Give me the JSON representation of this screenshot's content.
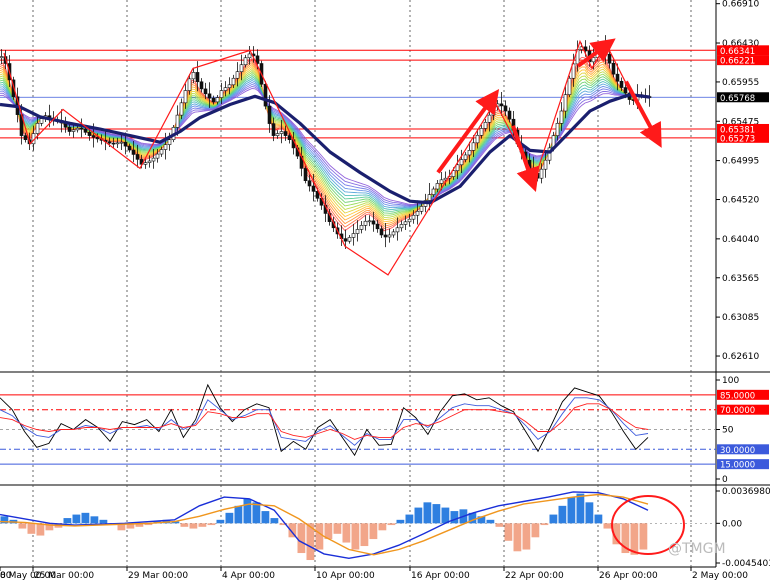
{
  "chart_data": [
    {
      "type": "line",
      "panel": "price",
      "title": "",
      "ylim": [
        0.62415,
        0.66955
      ],
      "y_ticks": [
        "0.66910",
        "0.66430",
        "0.65955",
        "0.65475",
        "0.64995",
        "0.64520",
        "0.64040",
        "0.63565",
        "0.63085",
        "0.62610"
      ],
      "price_tags": [
        {
          "label": "0.66341",
          "value": 0.66341,
          "color": "#ff0000"
        },
        {
          "label": "0.66221",
          "value": 0.66221,
          "color": "#ff0000"
        },
        {
          "label": "0.65768",
          "value": 0.65768,
          "color": "#000000"
        },
        {
          "label": "0.65381",
          "value": 0.65381,
          "color": "#ff0000"
        },
        {
          "label": "0.65273",
          "value": 0.65273,
          "color": "#ff0000"
        }
      ],
      "horizontal_lines": [
        {
          "value": 0.66341,
          "color": "#ff0000"
        },
        {
          "value": 0.66221,
          "color": "#ff0000"
        },
        {
          "value": 0.65768,
          "color": "#3c5adc"
        },
        {
          "value": 0.65381,
          "color": "#ff0000"
        },
        {
          "value": 0.65273,
          "color": "#ff0000"
        }
      ],
      "x_labels": [
        "25 Mar 00:00",
        "29 Mar 00:00",
        "4 Apr 00:00",
        "10 Apr 00:00",
        "16 Apr 00:00",
        "22 Apr 00:00",
        "26 Apr 00:00",
        "2 May 00:00",
        "8 May 00:00"
      ],
      "x_label_edge": "00",
      "price_path": [
        {
          "x": 0,
          "y": 0.6625
        },
        {
          "x": 4,
          "y": 0.6628
        },
        {
          "x": 10,
          "y": 0.6598
        },
        {
          "x": 17,
          "y": 0.6562
        },
        {
          "x": 22,
          "y": 0.653
        },
        {
          "x": 30,
          "y": 0.652
        },
        {
          "x": 38,
          "y": 0.6545
        },
        {
          "x": 45,
          "y": 0.6555
        },
        {
          "x": 52,
          "y": 0.655
        },
        {
          "x": 60,
          "y": 0.6548
        },
        {
          "x": 70,
          "y": 0.6535
        },
        {
          "x": 80,
          "y": 0.654
        },
        {
          "x": 90,
          "y": 0.653
        },
        {
          "x": 100,
          "y": 0.6525
        },
        {
          "x": 112,
          "y": 0.652
        },
        {
          "x": 122,
          "y": 0.6522
        },
        {
          "x": 132,
          "y": 0.651
        },
        {
          "x": 142,
          "y": 0.6495
        },
        {
          "x": 152,
          "y": 0.65
        },
        {
          "x": 160,
          "y": 0.651
        },
        {
          "x": 170,
          "y": 0.6525
        },
        {
          "x": 178,
          "y": 0.6555
        },
        {
          "x": 186,
          "y": 0.6585
        },
        {
          "x": 193,
          "y": 0.661
        },
        {
          "x": 200,
          "y": 0.659
        },
        {
          "x": 208,
          "y": 0.6578
        },
        {
          "x": 215,
          "y": 0.657
        },
        {
          "x": 222,
          "y": 0.6585
        },
        {
          "x": 230,
          "y": 0.6592
        },
        {
          "x": 238,
          "y": 0.6608
        },
        {
          "x": 246,
          "y": 0.6625
        },
        {
          "x": 252,
          "y": 0.6632
        },
        {
          "x": 258,
          "y": 0.6618
        },
        {
          "x": 264,
          "y": 0.658
        },
        {
          "x": 268,
          "y": 0.6552
        },
        {
          "x": 274,
          "y": 0.653
        },
        {
          "x": 282,
          "y": 0.6535
        },
        {
          "x": 290,
          "y": 0.6525
        },
        {
          "x": 298,
          "y": 0.6505
        },
        {
          "x": 306,
          "y": 0.6475
        },
        {
          "x": 314,
          "y": 0.6462
        },
        {
          "x": 322,
          "y": 0.6445
        },
        {
          "x": 330,
          "y": 0.6425
        },
        {
          "x": 338,
          "y": 0.641
        },
        {
          "x": 345,
          "y": 0.64
        },
        {
          "x": 352,
          "y": 0.6408
        },
        {
          "x": 360,
          "y": 0.6418
        },
        {
          "x": 368,
          "y": 0.6428
        },
        {
          "x": 376,
          "y": 0.642
        },
        {
          "x": 384,
          "y": 0.6405
        },
        {
          "x": 392,
          "y": 0.641
        },
        {
          "x": 400,
          "y": 0.642
        },
        {
          "x": 410,
          "y": 0.6428
        },
        {
          "x": 420,
          "y": 0.644
        },
        {
          "x": 430,
          "y": 0.6458
        },
        {
          "x": 440,
          "y": 0.6475
        },
        {
          "x": 450,
          "y": 0.648
        },
        {
          "x": 460,
          "y": 0.6498
        },
        {
          "x": 470,
          "y": 0.6512
        },
        {
          "x": 480,
          "y": 0.6535
        },
        {
          "x": 488,
          "y": 0.655
        },
        {
          "x": 496,
          "y": 0.657
        },
        {
          "x": 504,
          "y": 0.6565
        },
        {
          "x": 512,
          "y": 0.6545
        },
        {
          "x": 518,
          "y": 0.652
        },
        {
          "x": 524,
          "y": 0.6505
        },
        {
          "x": 530,
          "y": 0.649
        },
        {
          "x": 538,
          "y": 0.6478
        },
        {
          "x": 546,
          "y": 0.65
        },
        {
          "x": 554,
          "y": 0.653
        },
        {
          "x": 562,
          "y": 0.656
        },
        {
          "x": 570,
          "y": 0.66
        },
        {
          "x": 578,
          "y": 0.6635
        },
        {
          "x": 584,
          "y": 0.664
        },
        {
          "x": 590,
          "y": 0.662
        },
        {
          "x": 596,
          "y": 0.6628
        },
        {
          "x": 602,
          "y": 0.6638
        },
        {
          "x": 608,
          "y": 0.6625
        },
        {
          "x": 614,
          "y": 0.6605
        },
        {
          "x": 620,
          "y": 0.6592
        },
        {
          "x": 626,
          "y": 0.6582
        },
        {
          "x": 632,
          "y": 0.657
        },
        {
          "x": 638,
          "y": 0.658
        },
        {
          "x": 644,
          "y": 0.6578
        },
        {
          "x": 650,
          "y": 0.6577
        }
      ],
      "slow_ma": [
        {
          "x": 0,
          "y": 0.6568
        },
        {
          "x": 20,
          "y": 0.6565
        },
        {
          "x": 40,
          "y": 0.6553
        },
        {
          "x": 70,
          "y": 0.6545
        },
        {
          "x": 100,
          "y": 0.6538
        },
        {
          "x": 130,
          "y": 0.653
        },
        {
          "x": 160,
          "y": 0.6522
        },
        {
          "x": 180,
          "y": 0.6535
        },
        {
          "x": 200,
          "y": 0.6552
        },
        {
          "x": 230,
          "y": 0.6568
        },
        {
          "x": 255,
          "y": 0.6578
        },
        {
          "x": 275,
          "y": 0.657
        },
        {
          "x": 300,
          "y": 0.6545
        },
        {
          "x": 330,
          "y": 0.651
        },
        {
          "x": 360,
          "y": 0.6485
        },
        {
          "x": 390,
          "y": 0.6462
        },
        {
          "x": 410,
          "y": 0.645
        },
        {
          "x": 430,
          "y": 0.6448
        },
        {
          "x": 460,
          "y": 0.6468
        },
        {
          "x": 490,
          "y": 0.651
        },
        {
          "x": 510,
          "y": 0.653
        },
        {
          "x": 530,
          "y": 0.6512
        },
        {
          "x": 550,
          "y": 0.651
        },
        {
          "x": 570,
          "y": 0.6535
        },
        {
          "x": 590,
          "y": 0.656
        },
        {
          "x": 610,
          "y": 0.6572
        },
        {
          "x": 630,
          "y": 0.658
        },
        {
          "x": 650,
          "y": 0.6577
        }
      ],
      "ribbon_count": 16,
      "ribbon_colors": [
        "#ff4d4d",
        "#ff6a3a",
        "#ff8a2a",
        "#ffa62a",
        "#ffc22a",
        "#e0d030",
        "#b8d83a",
        "#8ed84a",
        "#66cf66",
        "#4dc88e",
        "#44b8b8",
        "#4aa0d8",
        "#5b88e6",
        "#6a72e8",
        "#7a60e0",
        "#8a55d8"
      ],
      "arrows": [
        {
          "from": [
            438,
            0.6485
          ],
          "to": [
            492,
            0.6575
          ]
        },
        {
          "from": [
            513,
            0.6542
          ],
          "to": [
            532,
            0.6475
          ]
        },
        {
          "from": [
            578,
            0.6615
          ],
          "to": [
            606,
            0.664
          ]
        },
        {
          "from": [
            626,
            0.6596
          ],
          "to": [
            656,
            0.6528
          ]
        }
      ],
      "zigzag": [
        [
          4,
          0.6631
        ],
        [
          30,
          0.652
        ],
        [
          63,
          0.6562
        ],
        [
          140,
          0.649
        ],
        [
          193,
          0.6612
        ],
        [
          250,
          0.6634
        ],
        [
          345,
          0.6395
        ],
        [
          388,
          0.636
        ],
        [
          495,
          0.6571
        ],
        [
          535,
          0.6478
        ],
        [
          580,
          0.6645
        ],
        [
          592,
          0.6612
        ],
        [
          606,
          0.6642
        ],
        [
          636,
          0.657
        ]
      ]
    },
    {
      "type": "line",
      "panel": "oscillator",
      "ylim": [
        0,
        100
      ],
      "y_ticks": [
        "100",
        "50",
        "0"
      ],
      "level_tags": [
        {
          "label": "85.0000",
          "value": 85,
          "color": "#ff0000"
        },
        {
          "label": "70.0000",
          "value": 70,
          "color": "#ff0000"
        },
        {
          "label": "30.0000",
          "value": 30,
          "color": "#3c5adc"
        },
        {
          "label": "15.0000",
          "value": 15,
          "color": "#3c5adc"
        }
      ],
      "series": [
        {
          "color": "#000000",
          "values": [
            82,
            70,
            48,
            32,
            36,
            56,
            50,
            60,
            52,
            38,
            58,
            55,
            60,
            48,
            70,
            42,
            60,
            95,
            72,
            58,
            70,
            76,
            72,
            28,
            38,
            30,
            52,
            60,
            42,
            24,
            50,
            34,
            35,
            72,
            62,
            45,
            68,
            84,
            86,
            80,
            82,
            74,
            68,
            48,
            28,
            52,
            78,
            92,
            88,
            84,
            68,
            48,
            30,
            42
          ]
        },
        {
          "color": "#3c5adc",
          "values": [
            70,
            64,
            52,
            44,
            42,
            50,
            50,
            54,
            52,
            46,
            52,
            52,
            54,
            50,
            60,
            50,
            56,
            80,
            70,
            60,
            64,
            70,
            70,
            42,
            40,
            38,
            48,
            54,
            44,
            34,
            46,
            40,
            40,
            60,
            60,
            52,
            62,
            72,
            76,
            74,
            74,
            70,
            66,
            54,
            40,
            48,
            66,
            82,
            82,
            80,
            70,
            56,
            44,
            46
          ]
        },
        {
          "color": "#ff2020",
          "values": [
            62,
            60,
            54,
            50,
            48,
            50,
            50,
            52,
            52,
            50,
            52,
            52,
            52,
            52,
            56,
            52,
            54,
            68,
            66,
            62,
            62,
            66,
            66,
            48,
            44,
            42,
            46,
            50,
            46,
            40,
            44,
            42,
            42,
            52,
            56,
            54,
            58,
            64,
            70,
            70,
            70,
            68,
            66,
            58,
            48,
            48,
            58,
            72,
            76,
            76,
            70,
            60,
            52,
            50
          ]
        }
      ]
    },
    {
      "type": "bar",
      "panel": "histogram",
      "y_ticks": [
        "0.0036980",
        "0.00",
        "-0.0045403"
      ],
      "bars": [
        0.0008,
        0.0004,
        -0.0006,
        -0.0012,
        -0.0014,
        -0.0008,
        -0.0005,
        0.0006,
        0.001,
        0.0012,
        0.0008,
        0.0004,
        -0.0002,
        -0.0008,
        -0.0006,
        -0.0004,
        -0.0002,
        0.0002,
        0.0004,
        0.0002,
        -0.0004,
        -0.0006,
        -0.0004,
        -0.0002,
        0.0004,
        0.0012,
        0.002,
        0.0028,
        0.0024,
        0.0014,
        0.0006,
        -0.0002,
        -0.0016,
        -0.0034,
        -0.0042,
        -0.003,
        -0.0018,
        -0.0012,
        -0.0022,
        -0.003,
        -0.0026,
        -0.0018,
        -0.0008,
        -0.0002,
        0.0004,
        0.001,
        0.0018,
        0.0024,
        0.0022,
        0.0018,
        0.0014,
        0.0016,
        0.0012,
        0.0008,
        0.0004,
        -0.0004,
        -0.002,
        -0.0032,
        -0.003,
        -0.0016,
        -0.0002,
        0.001,
        0.002,
        0.003,
        0.0034,
        0.0024,
        0.001,
        -0.0006,
        -0.0024,
        -0.0034,
        -0.0036,
        -0.003
      ],
      "signal_blue": [
        0.001,
        0.0005,
        0,
        -0.0002,
        -0.0001,
        0.0,
        0.0002,
        0.0004,
        0.002,
        0.003,
        0.0028,
        0.0015,
        -0.002,
        -0.0035,
        -0.004,
        -0.0035,
        -0.0025,
        -0.0012,
        0.0002,
        0.0012,
        0.002,
        0.0025,
        0.003,
        0.0036,
        0.0035,
        0.0028,
        0.0015
      ],
      "signal_orange": [
        0.0002,
        0.0001,
        -0.0002,
        -0.0003,
        -0.0002,
        -0.0001,
        0.0,
        0.0002,
        0.0008,
        0.0016,
        0.0022,
        0.002,
        0.0005,
        -0.0015,
        -0.003,
        -0.0036,
        -0.003,
        -0.002,
        -0.0008,
        0.0004,
        0.0014,
        0.0022,
        0.0026,
        0.003,
        0.0033,
        0.003,
        0.0022
      ]
    }
  ],
  "watermark": "@TMGM"
}
